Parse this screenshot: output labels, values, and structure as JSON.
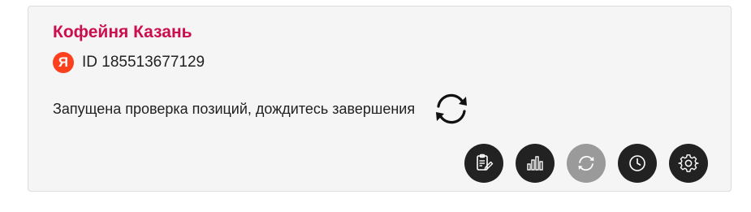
{
  "card": {
    "title": "Кофейня Казань",
    "provider_badge": "Я",
    "id_text": "ID 185513677129",
    "status_text": "Запущена проверка позиций, дождитесь завершения"
  },
  "actions": [
    {
      "icon": "edit-list-icon",
      "enabled": true
    },
    {
      "icon": "bar-chart-icon",
      "enabled": true
    },
    {
      "icon": "refresh-icon",
      "enabled": false
    },
    {
      "icon": "clock-icon",
      "enabled": true
    },
    {
      "icon": "gear-icon",
      "enabled": true
    }
  ],
  "colors": {
    "title": "#cc0e4f",
    "provider_badge": "#fc3f1d",
    "button": "#222222",
    "button_disabled": "#9a9a9a",
    "card_background": "#f5f5f5"
  }
}
